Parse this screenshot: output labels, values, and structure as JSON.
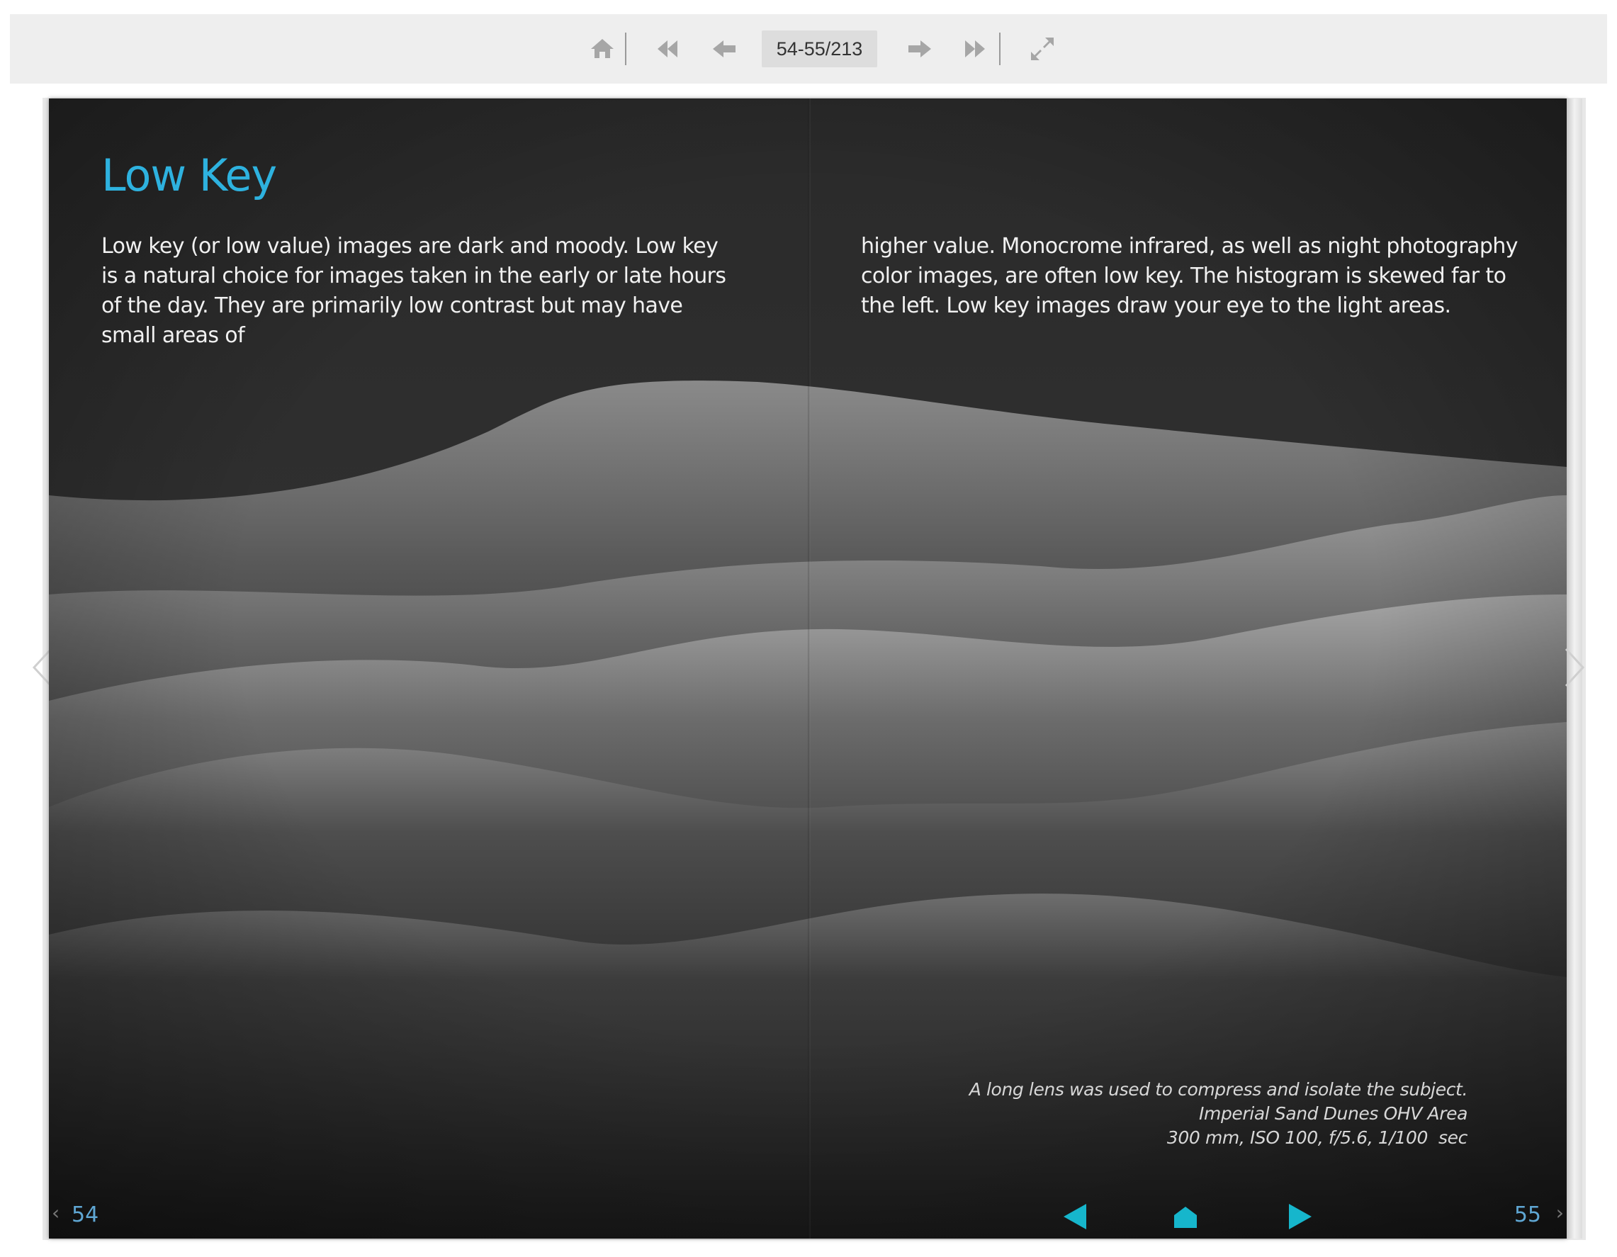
{
  "toolbar": {
    "page_indicator": "54-55/213",
    "icons": [
      "home-icon",
      "first-page-icon",
      "previous-page-icon",
      "next-page-icon",
      "last-page-icon",
      "fullscreen-icon"
    ],
    "icon_color": "#a6a6a6"
  },
  "spread": {
    "title": "Low Key",
    "left_text": "Low key (or low value) images are dark and moody.  Low key is a natural choice for images taken in the early or late hours of the day. They are primarily low contrast but may have small areas of",
    "right_text": "higher value. Monocrome infrared, as well as night photography color images, are often low key. The histogram is skewed far to the left. Low key images draw your eye to the light areas.",
    "caption": {
      "line1": "A long lens was used to compress and isolate the subject.",
      "line2": "Imperial Sand Dunes OHV Area",
      "line3": "300 mm, ISO 100, f/5.6, 1/100  sec"
    },
    "left_page_number": "54",
    "right_page_number": "55",
    "nav_icons": [
      "prev-triangle-icon",
      "home-house-icon",
      "next-triangle-icon"
    ],
    "title_color": "#2eb2df",
    "nav_color": "#16b6cc",
    "page_number_color": "#5fa7d4"
  }
}
